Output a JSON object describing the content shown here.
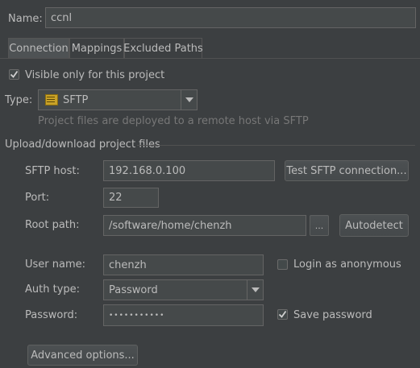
{
  "name": {
    "label": "Name:",
    "value": "ccnl"
  },
  "tabs": [
    {
      "label": "Connection",
      "selected": true
    },
    {
      "label": "Mappings",
      "selected": false
    },
    {
      "label": "Excluded Paths",
      "selected": false
    }
  ],
  "visible_only": {
    "label": "Visible only for this project",
    "checked": true
  },
  "type": {
    "label": "Type:",
    "value": "SFTP",
    "icon": "sftp-icon",
    "hint": "Project files are deployed to a remote host via SFTP"
  },
  "section": {
    "title": "Upload/download project files"
  },
  "host": {
    "label": "SFTP host:",
    "value": "192.168.0.100",
    "test_button": "Test SFTP connection..."
  },
  "port": {
    "label": "Port:",
    "value": "22"
  },
  "root": {
    "label": "Root path:",
    "value": "/software/home/chenzh",
    "browse": "...",
    "autodetect": "Autodetect"
  },
  "user": {
    "label": "User name:",
    "value": "chenzh",
    "anonymous_label": "Login as anonymous",
    "anonymous_checked": false
  },
  "auth": {
    "label": "Auth type:",
    "value": "Password"
  },
  "password": {
    "label": "Password:",
    "value": "•••••••••••",
    "save_label": "Save password",
    "save_checked": true
  },
  "advanced_button": "Advanced options...",
  "colors": {
    "background": "#3c3f41",
    "input": "#45494a",
    "text": "#bbbbbb",
    "hint": "#777777"
  }
}
